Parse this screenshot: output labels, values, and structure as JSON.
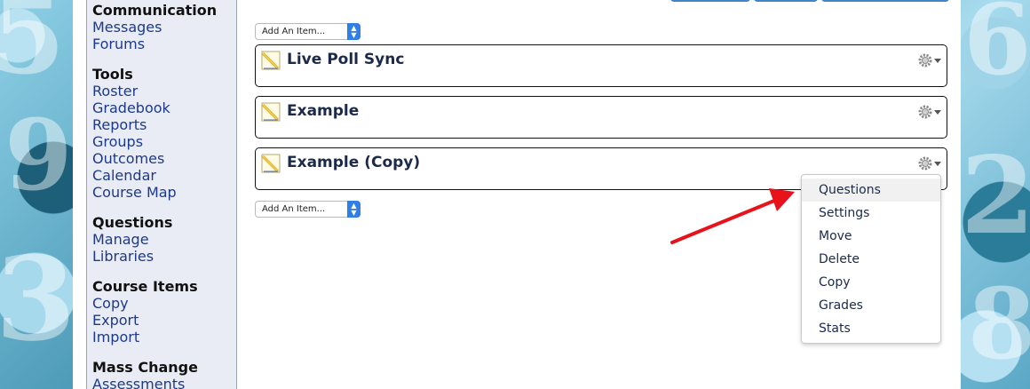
{
  "sidebar": {
    "sections": [
      {
        "heading": "Communication",
        "links": [
          "Messages",
          "Forums"
        ]
      },
      {
        "heading": "Tools",
        "links": [
          "Roster",
          "Gradebook",
          "Reports",
          "Groups",
          "Outcomes",
          "Calendar",
          "Course Map"
        ]
      },
      {
        "heading": "Questions",
        "links": [
          "Manage",
          "Libraries"
        ]
      },
      {
        "heading": "Course Items",
        "links": [
          "Copy",
          "Export",
          "Import"
        ]
      },
      {
        "heading": "Mass Change",
        "links": [
          "Assessments"
        ]
      }
    ]
  },
  "main": {
    "add_item_top": "Add An Item...",
    "add_item_bottom": "Add An Item...",
    "items": [
      {
        "title": "Live Poll Sync",
        "icon": "assessment-icon"
      },
      {
        "title": "Example",
        "icon": "assessment-icon"
      },
      {
        "title": "Example (Copy)",
        "icon": "assessment-icon"
      }
    ]
  },
  "context_menu": {
    "items": [
      "Questions",
      "Settings",
      "Move",
      "Delete",
      "Copy",
      "Grades",
      "Stats"
    ],
    "highlighted": "Questions"
  },
  "colors": {
    "link": "#1d3a8a",
    "accent_blue": "#2e7fe8",
    "arrow": "#e8121a",
    "sidebar_bg": "#e9ecf4"
  }
}
